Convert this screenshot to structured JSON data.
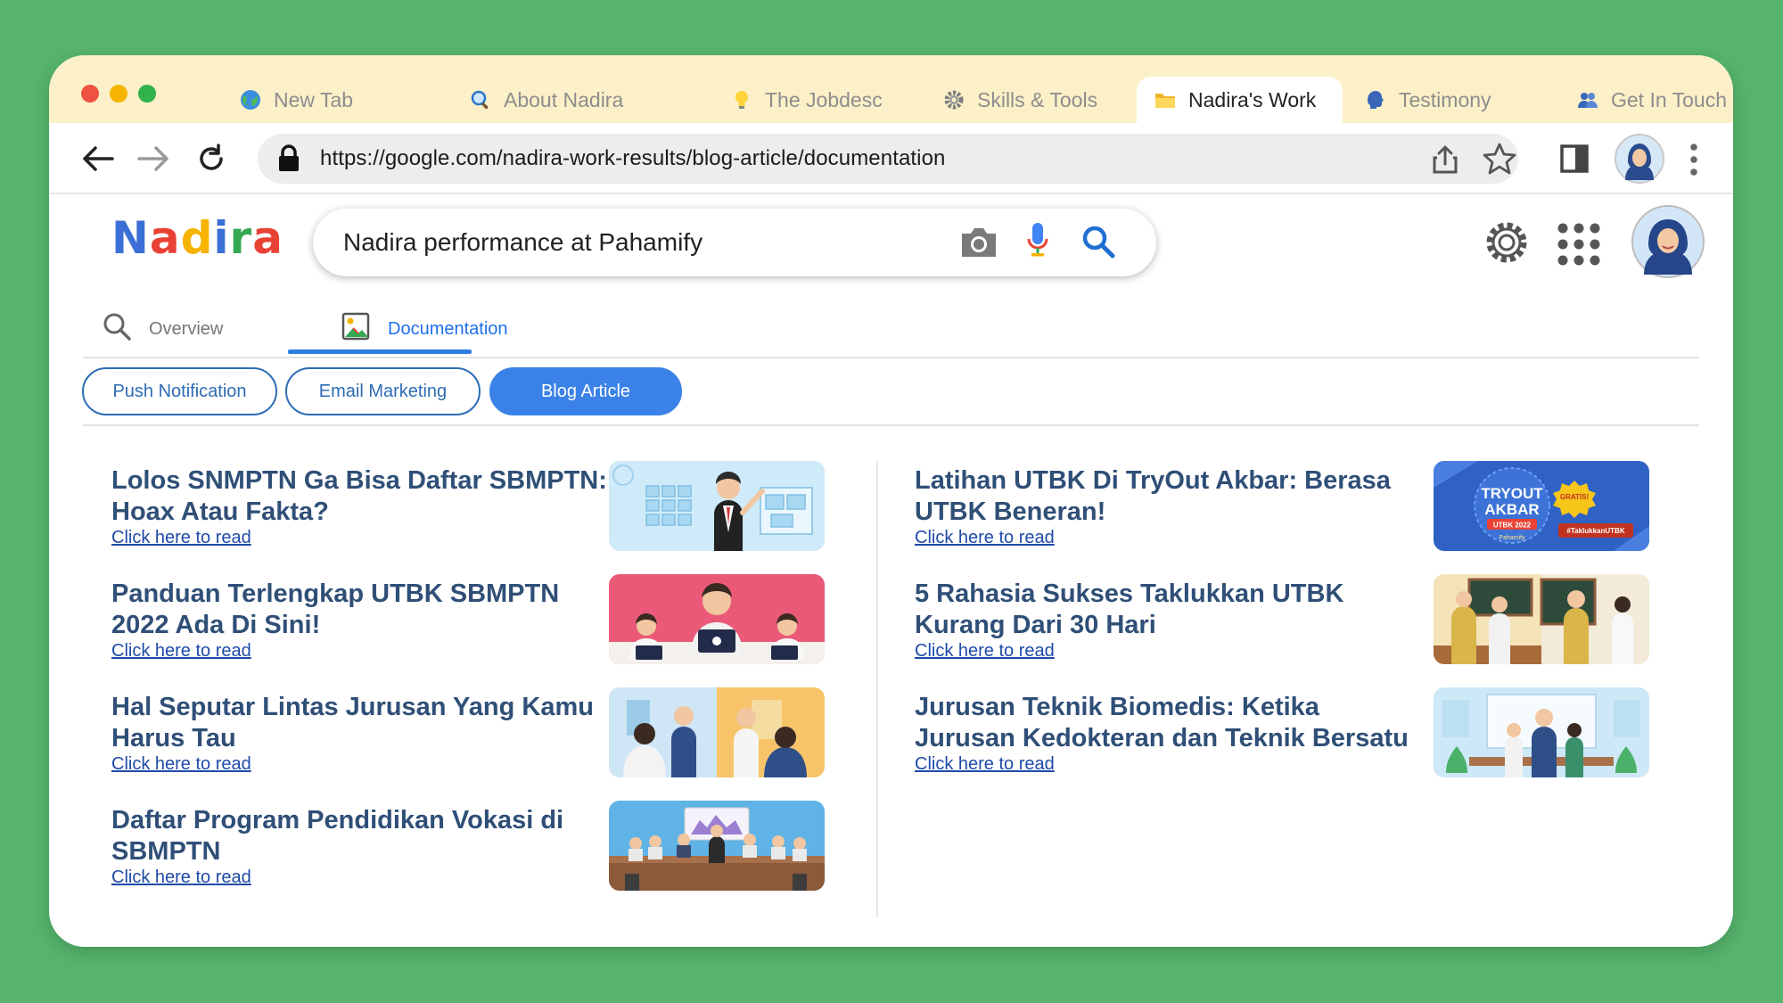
{
  "browser": {
    "tabs": [
      {
        "label": "New Tab",
        "icon": "globe-icon"
      },
      {
        "label": "About Nadira",
        "icon": "magnifier-icon"
      },
      {
        "label": "The Jobdesc",
        "icon": "lightbulb-icon"
      },
      {
        "label": "Skills & Tools",
        "icon": "gear-icon"
      },
      {
        "label": "Nadira's Work",
        "icon": "folder-icon",
        "active": true
      },
      {
        "label": "Testimony",
        "icon": "speaking-head-icon"
      },
      {
        "label": "Get In Touch",
        "icon": "people-icon"
      }
    ],
    "url": "https://google.com/nadira-work-results/blog-article/documentation"
  },
  "page": {
    "logo": [
      "N",
      "a",
      "d",
      "i",
      "r",
      "a"
    ],
    "logo_colors": [
      "#3b6fd6",
      "#e94235",
      "#f6b300",
      "#3b6fd6",
      "#34a853",
      "#e94235"
    ],
    "search_query": "Nadira performance at Pahamify",
    "subtabs": [
      {
        "label": "Overview",
        "icon": "search-icon"
      },
      {
        "label": "Documentation",
        "icon": "image-icon",
        "active": true
      }
    ],
    "chips": [
      {
        "label": "Push Notification"
      },
      {
        "label": "Email Marketing"
      },
      {
        "label": "Blog Article",
        "active": true
      }
    ],
    "link_text": "Click here to read",
    "articles_left": [
      {
        "title": "Lolos SNMPTN Ga Bisa Daftar SBMPTN: Hoax Atau Fakta?",
        "link": "Click here to read"
      },
      {
        "title": "Panduan Terlengkap UTBK SBMPTN 2022 Ada Di Sini!",
        "link": "Click here to read"
      },
      {
        "title": "Hal Seputar Lintas Jurusan Yang Kamu Harus Tau",
        "link": "Click here to read"
      },
      {
        "title": "Daftar Program Pendidikan Vokasi di SBMPTN",
        "link": "Click here to read"
      }
    ],
    "articles_right": [
      {
        "title": "Latihan UTBK Di TryOut Akbar: Berasa UTBK Beneran!",
        "link": "Click here to read"
      },
      {
        "title": "5 Rahasia Sukses Taklukkan UTBK Kurang Dari 30 Hari",
        "link": "Click here to read"
      },
      {
        "title": "Jurusan Teknik Biomedis: Ketika Jurusan Kedokteran dan Teknik Bersatu",
        "link": "Click here to read"
      }
    ],
    "thumb_text": {
      "tryout": "TRYOUT",
      "akbar": "AKBAR",
      "utbk": "UTBK 2022",
      "gratis": "GRATIS!",
      "hashtag": "#TaklukkanUTBK",
      "brand": "Pahamify"
    }
  }
}
